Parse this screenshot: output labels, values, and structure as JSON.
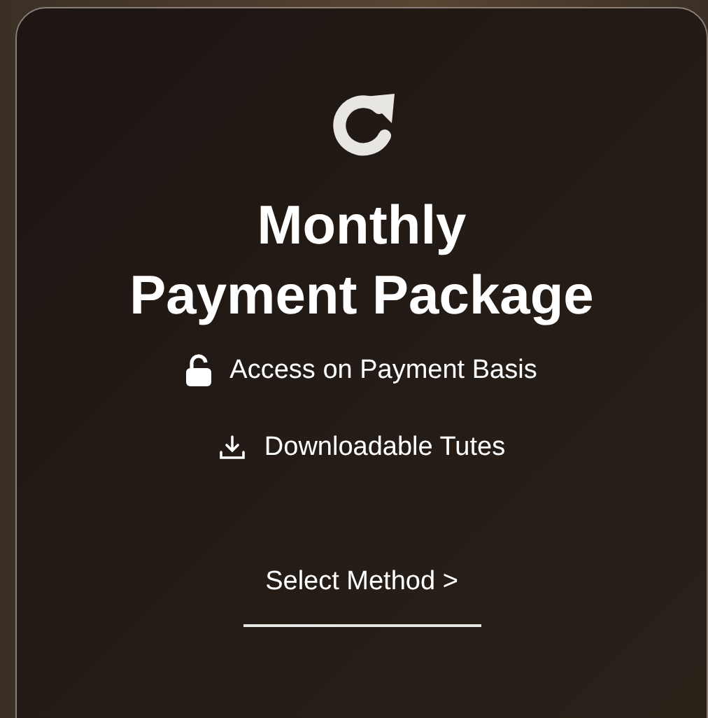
{
  "card": {
    "title_lines": [
      "Monthly",
      "Payment Package"
    ],
    "features": [
      {
        "kind": "access",
        "label": "Access on Payment Basis"
      },
      {
        "kind": "download",
        "label": "Downloadable Tutes"
      }
    ],
    "link": {
      "label": "Select Method",
      "arrow": ">"
    }
  }
}
